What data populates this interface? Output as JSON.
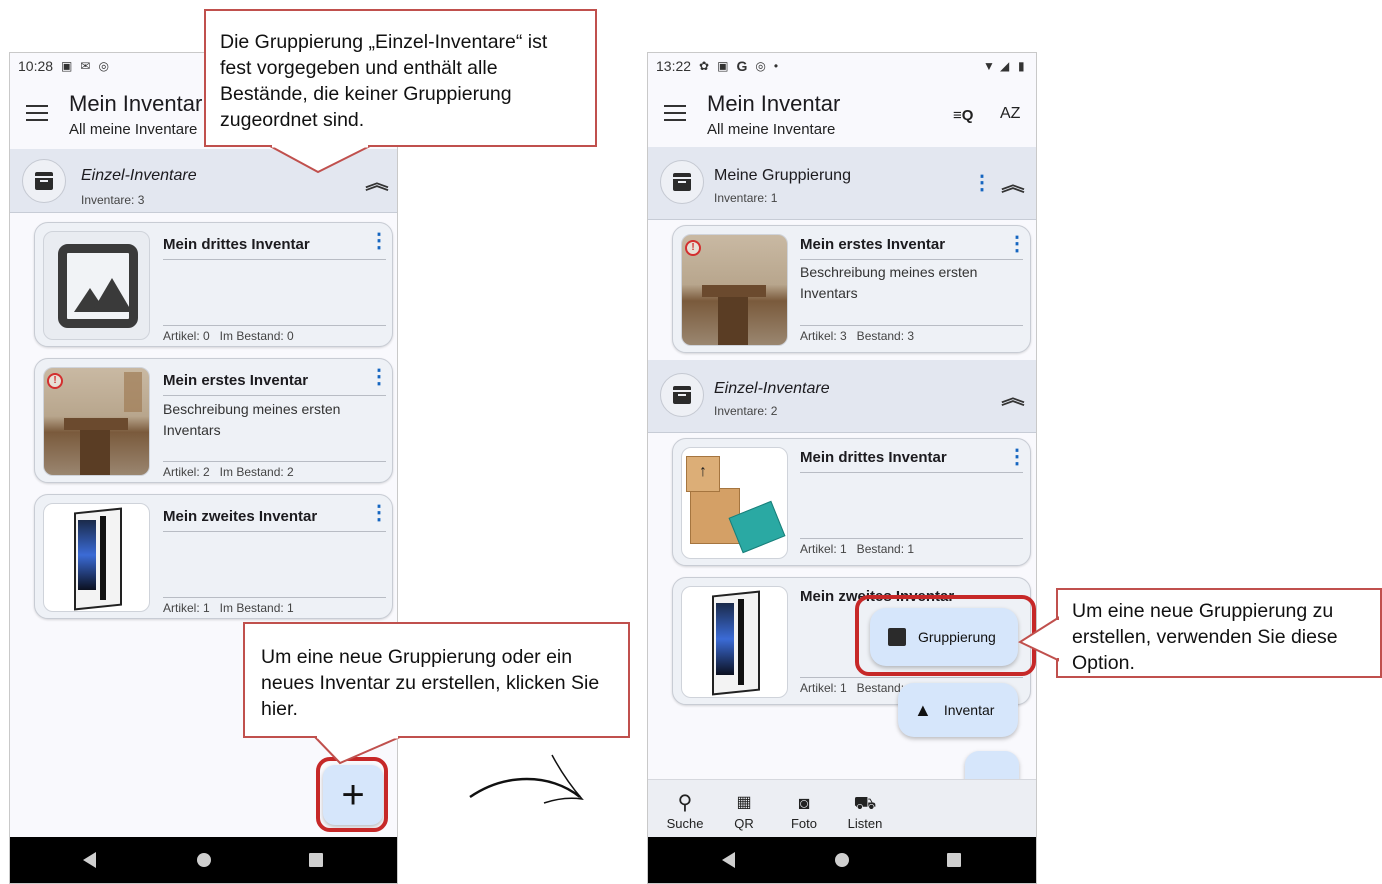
{
  "left": {
    "status_time": "10:28",
    "status_icons": [
      "notification-icon",
      "mail-icon",
      "sync-icon"
    ],
    "title": "Mein Inventar",
    "subtitle": "All meine Inventare",
    "group": {
      "name": "Einzel-Inventare",
      "count": "Inventare: 3"
    },
    "cards": [
      {
        "name": "Mein drittes Inventar",
        "desc1": "",
        "desc2": "",
        "meta": "Artikel: 0   Im Bestand: 0",
        "image": "placeholder-image",
        "warn": false
      },
      {
        "name": "Mein erstes Inventar",
        "desc1": "Beschreibung meines ersten",
        "desc2": "Inventars",
        "meta": "Artikel: 2   Im Bestand: 2",
        "image": "room-photo",
        "warn": true
      },
      {
        "name": "Mein zweites Inventar",
        "desc1": "",
        "desc2": "",
        "meta": "Artikel: 1   Im Bestand: 1",
        "image": "pc-case-photo",
        "warn": false
      }
    ],
    "fab_icon": "+"
  },
  "right": {
    "status_time": "13:22",
    "status_icons": [
      "gear-icon",
      "notification-icon",
      "google-icon",
      "sync-icon",
      "dot-icon"
    ],
    "status_right": [
      "wifi-icon",
      "signal-icon",
      "battery-icon"
    ],
    "title": "Mein Inventar",
    "subtitle": "All meine Inventare",
    "action_filter": "≡Q",
    "action_sort": "AZ",
    "groups": [
      {
        "name": "Meine Gruppierung",
        "count": "Inventare: 1"
      },
      {
        "name": "Einzel-Inventare",
        "count": "Inventare: 2"
      }
    ],
    "cards": [
      {
        "name": "Mein erstes Inventar",
        "desc1": "Beschreibung meines ersten",
        "desc2": "Inventars",
        "meta": "Artikel: 3   Bestand: 3"
      },
      {
        "name": "Mein drittes Inventar",
        "meta": "Artikel: 1   Bestand: 1"
      },
      {
        "name": "Mein zweites Inventar",
        "meta": "Artikel: 1   Bestand: 1"
      }
    ],
    "fab_group": "Gruppierung",
    "fab_inventory": "Inventar",
    "bottom_nav": [
      {
        "label": "Suche",
        "icon": "search-icon"
      },
      {
        "label": "QR",
        "icon": "qr-icon"
      },
      {
        "label": "Foto",
        "icon": "camera-icon"
      },
      {
        "label": "Listen",
        "icon": "cart-icon"
      }
    ]
  },
  "callouts": {
    "top": "Die Gruppierung „Einzel-Inventare“ ist fest vorgegeben und enthält alle Bestände, die keiner Gruppierung zugeordnet sind.",
    "bottom": "Um eine neue Gruppierung oder ein neues Inventar zu erstellen, klicken Sie hier.",
    "right": "Um eine neue Gruppierung zu erstellen, verwenden Sie diese Option."
  }
}
